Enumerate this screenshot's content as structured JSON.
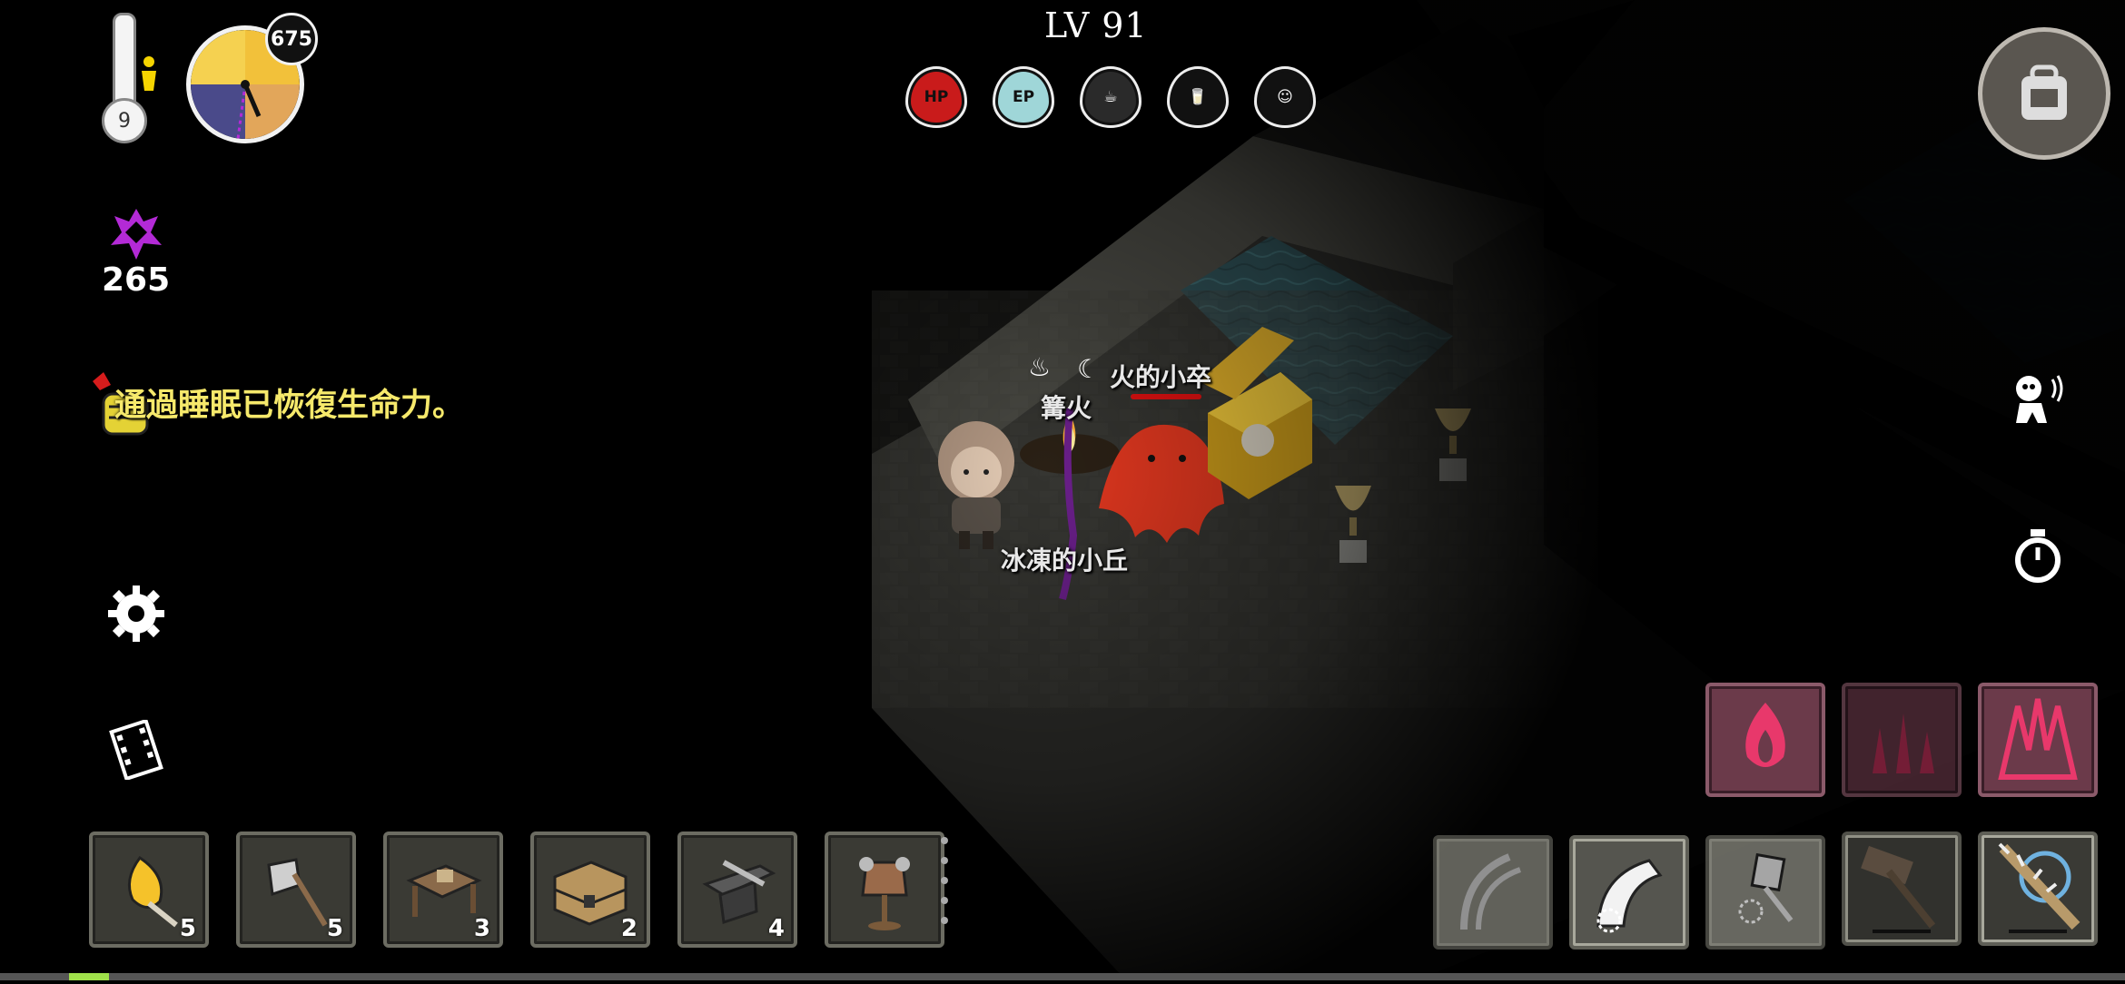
{
  "hud": {
    "level_text": "LV 91",
    "thermometer_value": "9",
    "clock_badge": "675",
    "sanity_value": "265",
    "message": "通過睡眠已恢復生命力。"
  },
  "status_icons": [
    {
      "label": "HP",
      "color": "#c91b1b",
      "name": "hp-icon"
    },
    {
      "label": "EP",
      "color": "#9fd6d8",
      "name": "ep-icon"
    },
    {
      "label": "",
      "color": "#222222",
      "name": "hunger-icon"
    },
    {
      "label": "",
      "color": "#111111",
      "name": "thirst-icon"
    },
    {
      "label": "",
      "color": "#111111",
      "name": "mood-icon"
    }
  ],
  "world_labels": {
    "campfire": "篝火",
    "enemy": "火的小卒",
    "hill": "冰凍的小丘"
  },
  "hotbar": [
    {
      "name": "torch-slot",
      "icon": "torch-icon",
      "count": "5"
    },
    {
      "name": "axe-slot",
      "icon": "axe-icon",
      "count": "5"
    },
    {
      "name": "workbench-slot",
      "icon": "workbench-icon",
      "count": "3"
    },
    {
      "name": "chest-slot",
      "icon": "chest-icon",
      "count": "2"
    },
    {
      "name": "anvil-slot",
      "icon": "anvil-icon",
      "count": "4"
    },
    {
      "name": "armor-stand-slot",
      "icon": "armor-stand-icon",
      "count": ""
    }
  ],
  "skills": [
    {
      "name": "fire-skill-1",
      "icon": "flame-icon"
    },
    {
      "name": "fire-skill-2",
      "icon": "flame-wall-icon"
    },
    {
      "name": "fire-skill-3",
      "icon": "flame-burst-icon"
    }
  ],
  "tools": [
    {
      "name": "claw-slash-tool",
      "icon": "claw-icon"
    },
    {
      "name": "claw-strike-tool",
      "icon": "claw-hit-icon"
    },
    {
      "name": "hammer-strike-tool",
      "icon": "hammer-hit-icon"
    },
    {
      "name": "hammer-tool",
      "icon": "hammer-icon"
    },
    {
      "name": "spiked-club-tool",
      "icon": "spiked-club-icon"
    }
  ],
  "colors": {
    "accent_yellow": "#f6e96b",
    "skill_bg": "#6b3a4a",
    "sanity_purple": "#b32ad6",
    "water": "#2f4d52"
  }
}
